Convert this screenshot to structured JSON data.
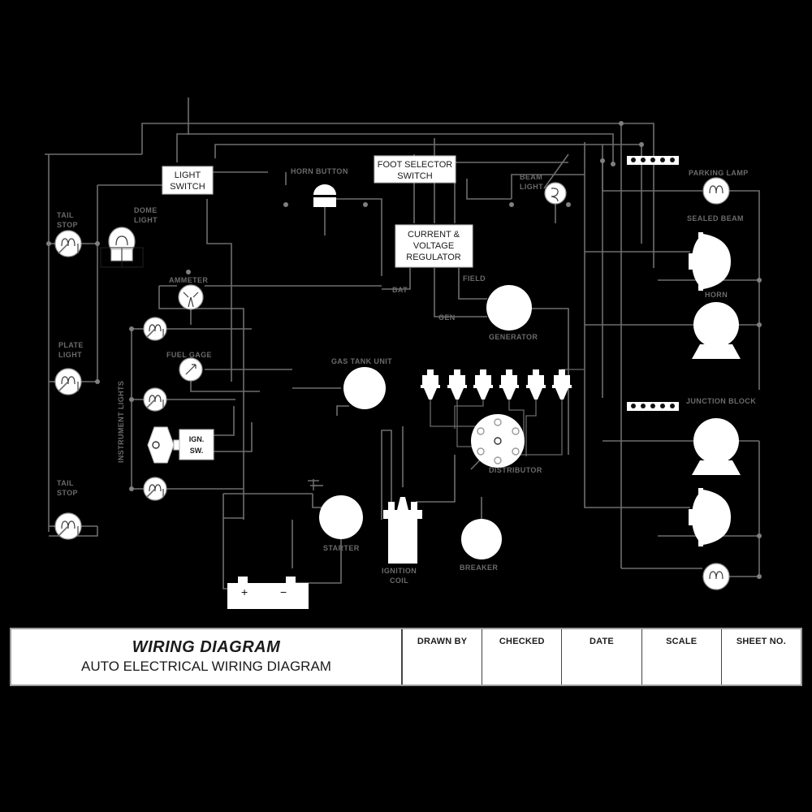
{
  "drawing": {
    "title": "WIRING DIAGRAM",
    "subtitle": "AUTO ELECTRICAL WIRING DIAGRAM",
    "background": "#000000",
    "wire_color": "#6e6e6e",
    "label_color": "#6b6b6b",
    "component_fill": "#ffffff"
  },
  "title_block": {
    "columns": [
      {
        "header": "DRAWN BY",
        "value": ""
      },
      {
        "header": "CHECKED",
        "value": ""
      },
      {
        "header": "DATE",
        "value": ""
      },
      {
        "header": "SCALE",
        "value": ""
      },
      {
        "header": "SHEET NO.",
        "value": ""
      }
    ]
  },
  "labels": {
    "tail_stop_top": "TAIL\nSTOP",
    "tail_stop_top_l1": "TAIL",
    "tail_stop_top_l2": "STOP",
    "dome_light_l1": "DOME",
    "dome_light_l2": "LIGHT",
    "plate_light_l1": "PLATE",
    "plate_light_l2": "LIGHT",
    "tail_stop_bot_l1": "TAIL",
    "tail_stop_bot_l2": "STOP",
    "instrument_lights": "INSTRUMENT LIGHTS",
    "ammeter": "AMMETER",
    "fuel_gage": "FUEL GAGE",
    "gas_tank_unit": "GAS TANK UNIT",
    "horn_button": "HORN BUTTON",
    "beam_light_l1": "BEAM",
    "beam_light_l2": "LIGHT",
    "bat": "BAT",
    "field": "FIELD",
    "gen": "GEN",
    "generator": "GENERATOR",
    "parking_lamp": "PARKING LAMP",
    "sealed_beam": "SEALED BEAM",
    "horn": "HORN",
    "junction_block": "JUNCTION BLOCK",
    "distributor": "DISTRIBUTOR",
    "starter": "STARTER",
    "ignition_coil_l1": "IGNITION",
    "ignition_coil_l2": "COIL",
    "breaker": "BREAKER"
  },
  "boxes": {
    "light_switch": {
      "l1": "LIGHT",
      "l2": "SWITCH"
    },
    "foot_selector_switch": {
      "l1": "FOOT SELECTOR",
      "l2": "SWITCH"
    },
    "regulator": {
      "l1": "CURRENT &",
      "l2": "VOLTAGE",
      "l3": "REGULATOR"
    },
    "ign_sw": {
      "l1": "IGN.",
      "l2": "SW."
    }
  },
  "battery": {
    "positive": "+",
    "negative": "−"
  },
  "counts": {
    "spark_plugs": 6,
    "distributor_terminals": 6,
    "junction_block_top_terminals": 5,
    "junction_block_bottom_terminals": 5
  }
}
